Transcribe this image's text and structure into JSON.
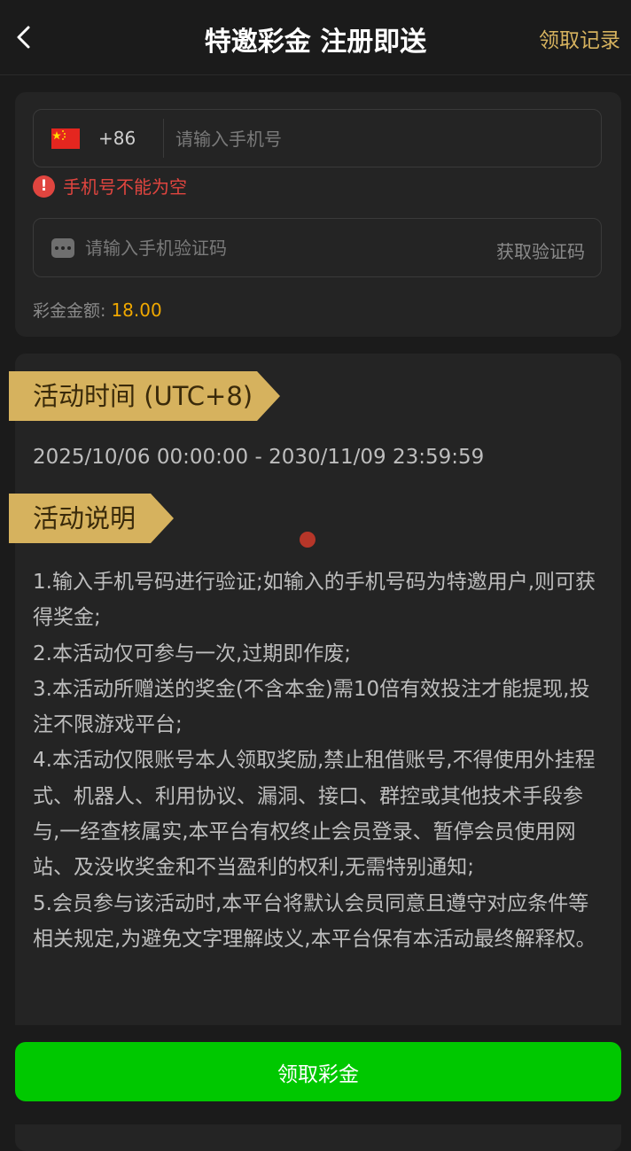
{
  "header": {
    "title": "特邀彩金 注册即送",
    "record_label": "领取记录",
    "back_icon": "chevron-left-icon"
  },
  "form": {
    "country_flag": "china-flag-icon",
    "country_code": "+86",
    "phone_placeholder": "请输入手机号",
    "phone_value": "",
    "error_text": "手机号不能为空",
    "sms_placeholder": "请输入手机验证码",
    "sms_value": "",
    "get_code_label": "获取验证码",
    "amount_label": "彩金金额:",
    "amount_value": "18.00"
  },
  "activity": {
    "time_title": "活动时间 (UTC+8)",
    "time_range": "2025/10/06 00:00:00 - 2030/11/09 23:59:59",
    "desc_title": "活动说明",
    "rules": [
      "1.输入手机号码进行验证;如输入的手机号码为特邀用户,则可获得奖金;",
      "2.本活动仅可参与一次,过期即作废;",
      "3.本活动所赠送的奖金(不含本金)需10倍有效投注才能提现,投注不限游戏平台;",
      "4.本活动仅限账号本人领取奖励,禁止租借账号,不得使用外挂程式、机器人、利用协议、漏洞、接口、群控或其他技术手段参与,一经查核属实,本平台有权终止会员登录、暂停会员使用网站、及没收奖金和不当盈利的权利,无需特别通知;",
      "5.会员参与该活动时,本平台将默认会员同意且遵守对应条件等相关规定,为避免文字理解歧义,本平台保有本活动最终解释权。"
    ]
  },
  "footer": {
    "claim_label": "领取彩金"
  },
  "colors": {
    "accent_gold": "#d6b25e",
    "error_red": "#e0453f",
    "amount_orange": "#f0a800",
    "button_green": "#00c800"
  }
}
